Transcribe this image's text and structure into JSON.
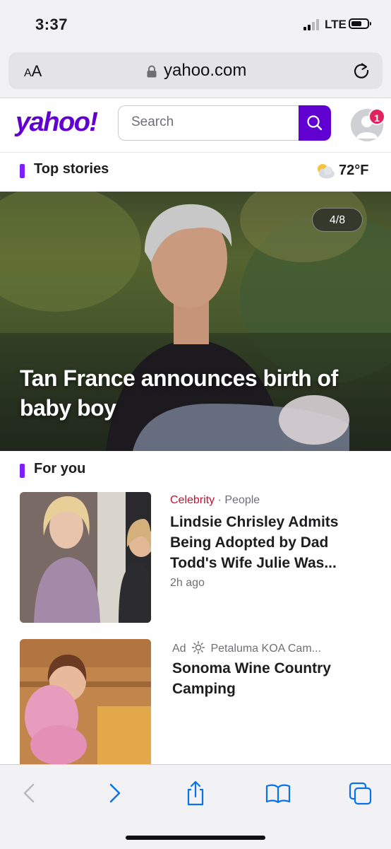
{
  "status_bar": {
    "time": "3:37",
    "network": "LTE"
  },
  "browser": {
    "text_size_label_small": "A",
    "text_size_label_large": "A",
    "url": "yahoo.com"
  },
  "header": {
    "logo": "yahoo!",
    "search_placeholder": "Search",
    "notification_count": "1"
  },
  "top_stories": {
    "section_label": "Top stories",
    "weather_temp": "72°F",
    "hero": {
      "counter": "4/8",
      "title": "Tan France announces birth of baby boy"
    }
  },
  "for_you": {
    "section_label": "For you",
    "items": [
      {
        "category": "Celebrity",
        "separator": "·",
        "source": "People",
        "title": "Lindsie Chrisley Admits Being Adopted by Dad Todd's Wife Julie Was...",
        "time": "2h ago"
      },
      {
        "ad_label": "Ad",
        "source": "Petaluma KOA Cam...",
        "title": "Sonoma Wine Country Camping"
      }
    ]
  },
  "colors": {
    "brand": "#6001d2",
    "accent_bar": "#7e1fff",
    "category": "#c8102e",
    "badge": "#e0245e"
  }
}
